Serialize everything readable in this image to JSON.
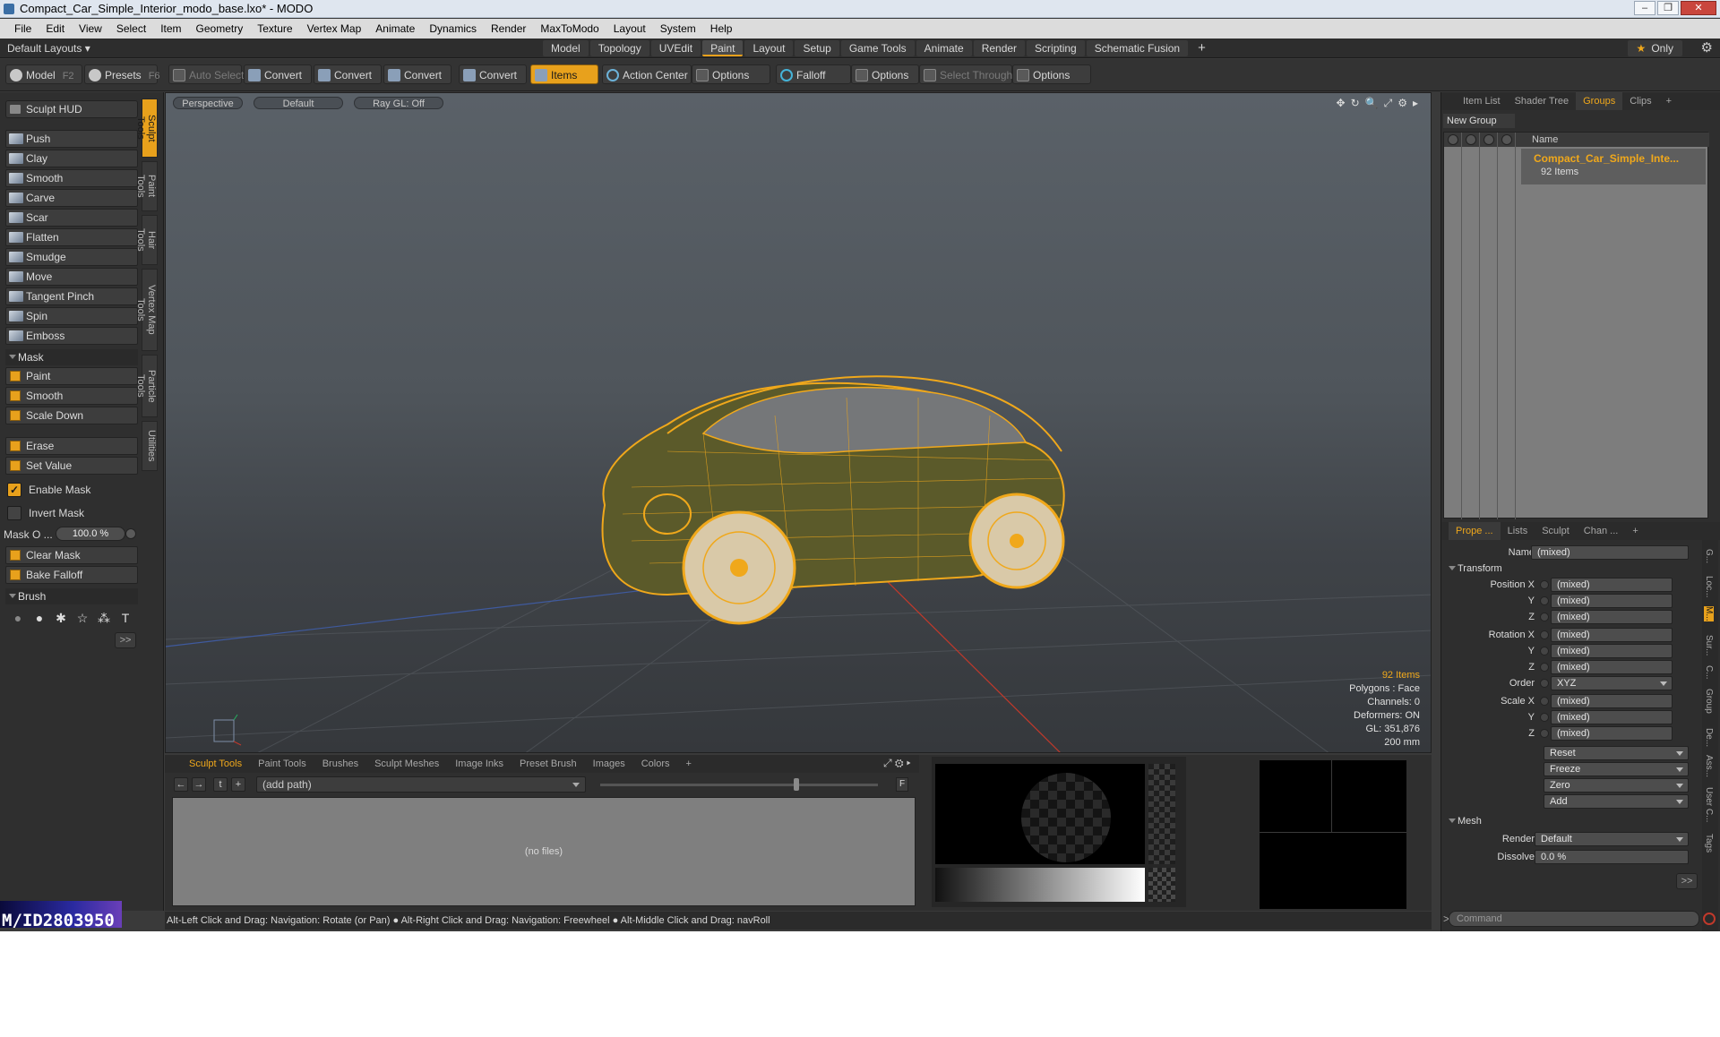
{
  "window": {
    "title": "Compact_Car_Simple_Interior_modo_base.lxo* - MODO",
    "buttons": [
      "–",
      "❐",
      "✕"
    ]
  },
  "menu": [
    "File",
    "Edit",
    "View",
    "Select",
    "Item",
    "Geometry",
    "Texture",
    "Vertex Map",
    "Animate",
    "Dynamics",
    "Render",
    "MaxToModo",
    "Layout",
    "System",
    "Help"
  ],
  "layout": {
    "default_layouts": "Default Layouts ▾",
    "tabs": [
      "Model",
      "Topology",
      "UVEdit",
      "Paint",
      "Layout",
      "Setup",
      "Game Tools",
      "Animate",
      "Render",
      "Scripting",
      "Schematic Fusion"
    ],
    "active_tab": "Paint",
    "plus": "+",
    "only": "Only",
    "star": "★",
    "gear": "⚙"
  },
  "toolbar": {
    "model": "Model",
    "model_key": "F2",
    "presets": "Presets",
    "presets_key": "F6",
    "auto_select": "Auto Select",
    "convert1": "Convert",
    "convert2": "Convert",
    "convert3": "Convert",
    "convert4": "Convert",
    "items": "Items",
    "action_center": "Action Center",
    "options1": "Options",
    "falloff": "Falloff",
    "options2": "Options",
    "select_through": "Select Through",
    "options3": "Options"
  },
  "left": {
    "hud": "Sculpt HUD",
    "sidetabs": [
      "Sculpt Tools",
      "Paint Tools",
      "Hair Tools",
      "Vertex Map Tools",
      "Particle Tools",
      "Utilities"
    ],
    "tools": [
      "Push",
      "Clay",
      "Smooth",
      "Carve",
      "Scar",
      "Flatten",
      "Smudge",
      "Move",
      "Tangent Pinch",
      "Spin",
      "Emboss"
    ],
    "mask_section": "Mask",
    "mask_tools": [
      "Paint",
      "Smooth",
      "Scale Down"
    ],
    "erase": "Erase",
    "set_value": "Set Value",
    "enable_mask": "Enable Mask",
    "invert_mask": "Invert Mask",
    "mask_opacity_label": "Mask O ...",
    "mask_opacity": "100.0 %",
    "clear_mask": "Clear Mask",
    "bake_falloff": "Bake Falloff",
    "brush_section": "Brush",
    "more": ">>",
    "brush_icons": [
      "●",
      "●",
      "✱",
      "☆",
      "⁂",
      "T"
    ]
  },
  "watermark": "M/ID2803950",
  "viewport": {
    "perspective": "Perspective",
    "default": "Default",
    "raygl": "Ray GL: Off",
    "icons": [
      "✥",
      "↻",
      "🔍",
      "⤢",
      "⚙",
      "▸"
    ],
    "stats": {
      "items": "92 Items",
      "polygons": "Polygons : Face",
      "channels": "Channels: 0",
      "deformers": "Deformers: ON",
      "gl": "GL: 351,876",
      "scale": "200 mm"
    }
  },
  "bottom": {
    "tabs": [
      "Sculpt Tools",
      "Paint Tools",
      "Brushes",
      "Sculpt Meshes",
      "Image Inks",
      "Preset Brush",
      "Images",
      "Colors",
      "+"
    ],
    "active_tab": "Sculpt Tools",
    "icons": "⤢ ⚙ ▸",
    "nav": [
      "←",
      "→",
      "t",
      "+"
    ],
    "path": "(add path)",
    "f": "F",
    "no_files": "(no files)"
  },
  "status": "Alt-Left Click and Drag: Navigation: Rotate (or Pan) ● Alt-Right Click and Drag: Navigation: Freewheel ● Alt-Middle Click and Drag: navRoll",
  "right": {
    "tabs": [
      "Item List",
      "Shader Tree",
      "Groups",
      "Clips",
      "+"
    ],
    "active_tab": "Groups",
    "new_group": "New Group",
    "name_col": "Name",
    "group_name": "Compact_Car_Simple_Inte...",
    "group_items": "92 Items",
    "ptabs": [
      "Prope ...",
      "Lists",
      "Sculpt",
      "Chan ...",
      "+"
    ],
    "active_ptab": "Prope ...",
    "props": {
      "name_label": "Name",
      "name_value": "(mixed)",
      "transform": "Transform",
      "pos_x": "Position X",
      "y": "Y",
      "z": "Z",
      "rot_x": "Rotation X",
      "order_label": "Order",
      "order_value": "XYZ",
      "scale_x": "Scale X",
      "mixed": "(mixed)",
      "reset": "Reset",
      "freeze": "Freeze",
      "zero": "Zero",
      "add": "Add",
      "mesh": "Mesh",
      "render_label": "Render",
      "render_value": "Default",
      "dissolve_label": "Dissolve",
      "dissolve_value": "0.0 %",
      "more": ">>"
    },
    "side_tabs": [
      "G...",
      "Loc...",
      "M...",
      "Sur...",
      "C...",
      "Group",
      "De...",
      "Ass...",
      "User C...",
      "Tags"
    ],
    "command": "Command",
    "cmd_arrow": ">"
  }
}
